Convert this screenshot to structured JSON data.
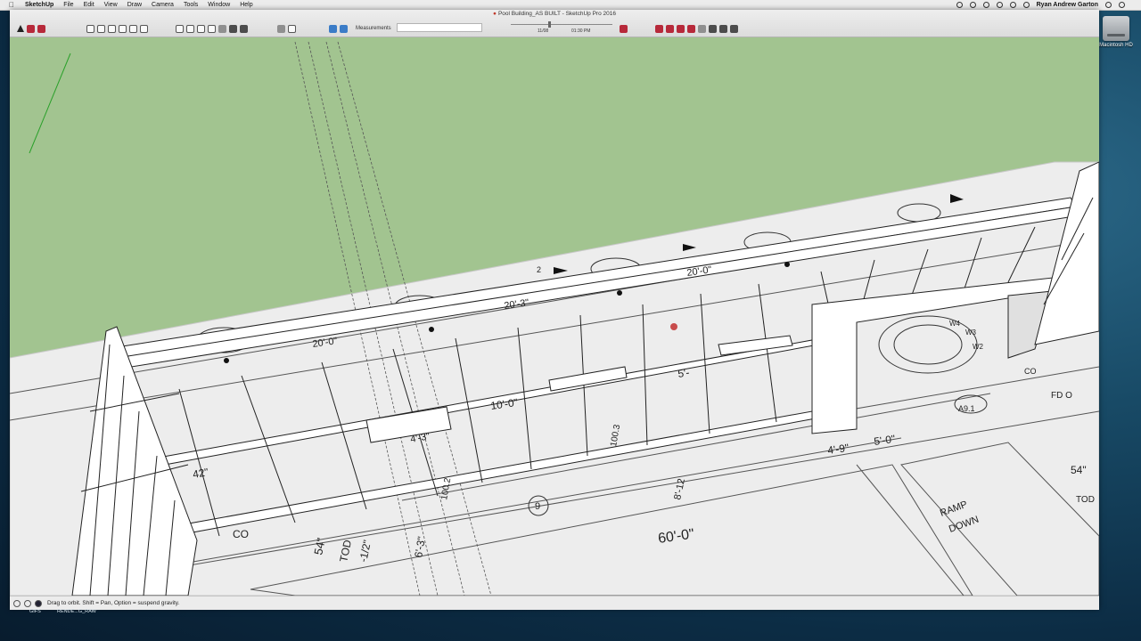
{
  "menubar": {
    "app_name": "SketchUp",
    "menus": [
      "File",
      "Edit",
      "View",
      "Draw",
      "Camera",
      "Tools",
      "Window",
      "Help"
    ],
    "user": "Ryan Andrew Garton"
  },
  "window": {
    "title": "Pool Building_AS BUILT - SketchUp Pro 2016"
  },
  "toolbar": {
    "measurements_label": "Measurements",
    "measurements_value": "",
    "shadow_date": "11/08",
    "shadow_time": "01:30 PM"
  },
  "status": {
    "hint": "Drag to orbit. Shift = Pan, Option = suspend gravity."
  },
  "desktop": {
    "drive_label": "Macintosh HD",
    "bottom_labels": [
      "GIFS",
      "RENDE...G_RAW"
    ]
  },
  "drawing_labels": {
    "dim_60": "60'-0\"",
    "dim_54a": "54\"",
    "dim_54b": "54\"",
    "tod": "TOD",
    "frac": "-1/2\"",
    "dim_6_3": "6'-3\"",
    "dim_100_2": "100.2",
    "dim_100_3": "100.3",
    "dim_10_0": "10'-0\"",
    "dim_4_3": "4'-3\"",
    "dim_20_0a": "20'-0\"",
    "dim_20_3": "20'-3\"",
    "dim_20_0b": "20'-0\"",
    "dim_5": "5'-",
    "dim_4_9": "4'-9\"",
    "dim_5_0": "5'-0\"",
    "dim_42": "42\"",
    "dim_8_12": "8'-12",
    "callout_9": "9",
    "callout_2": "2",
    "ramp": "RAMP",
    "down": "DOWN",
    "co_a": "CO",
    "co_b": "CO",
    "fdo": "FD O",
    "tod_2": "TOD",
    "a9": "A9.1",
    "w4": "W4",
    "w3": "W3",
    "w2": "W2"
  }
}
